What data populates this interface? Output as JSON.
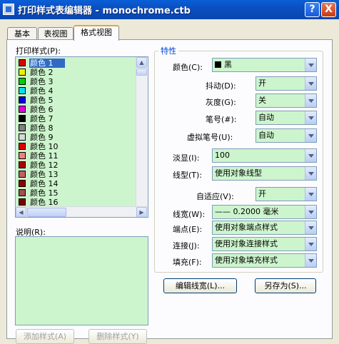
{
  "window": {
    "title": "打印样式表编辑器 - monochrome.ctb",
    "help_label": "?",
    "close_label": "X"
  },
  "tabs": [
    {
      "label": "基本"
    },
    {
      "label": "表视图"
    },
    {
      "label": "格式视图"
    }
  ],
  "styles_list": {
    "label": "打印样式(P):",
    "items": [
      {
        "label": "颜色 1",
        "color": "#e00000"
      },
      {
        "label": "颜色 2",
        "color": "#f0f000"
      },
      {
        "label": "颜色 3",
        "color": "#00d000"
      },
      {
        "label": "颜色 4",
        "color": "#00e0f0"
      },
      {
        "label": "颜色 5",
        "color": "#0000e0"
      },
      {
        "label": "颜色 6",
        "color": "#e000e0"
      },
      {
        "label": "颜色 7",
        "color": "#000000"
      },
      {
        "label": "颜色 8",
        "color": "#808080"
      },
      {
        "label": "颜色 9",
        "color": "#d8d8d8"
      },
      {
        "label": "颜色 10",
        "color": "#e00000"
      },
      {
        "label": "颜色 11",
        "color": "#f08080"
      },
      {
        "label": "颜色 12",
        "color": "#b00000"
      },
      {
        "label": "颜色 13",
        "color": "#c06060"
      },
      {
        "label": "颜色 14",
        "color": "#900000"
      },
      {
        "label": "颜色 15",
        "color": "#a05050"
      },
      {
        "label": "颜色 16",
        "color": "#800000"
      }
    ],
    "selected_index": 0
  },
  "description": {
    "label": "说明(R):",
    "value": ""
  },
  "buttons": {
    "add_style": "添加样式(A)",
    "delete_style": "删除样式(Y)",
    "edit_lineweights": "编辑线宽(L)...",
    "save_as": "另存为(S)..."
  },
  "properties": {
    "group_title": "特性",
    "color": {
      "label": "颜色(C):",
      "value": "黑"
    },
    "dither": {
      "label": "抖动(D):",
      "value": "开"
    },
    "grayscale": {
      "label": "灰度(G):",
      "value": "关"
    },
    "pen": {
      "label": "笔号(#):",
      "value": "自动"
    },
    "virtual_pen": {
      "label": "虚拟笔号(U):",
      "value": "自动"
    },
    "screening": {
      "label": "淡显(I):",
      "value": "100"
    },
    "linetype": {
      "label": "线型(T):",
      "value": "使用对象线型"
    },
    "adaptive": {
      "label": "自适应(V):",
      "value": "开"
    },
    "lineweight": {
      "label": "线宽(W):",
      "value": "—— 0.2000 毫米"
    },
    "line_end": {
      "label": "端点(E):",
      "value": "使用对象端点样式"
    },
    "line_join": {
      "label": "连接(J):",
      "value": "使用对象连接样式"
    },
    "fill": {
      "label": "填充(F):",
      "value": "使用对象填充样式"
    }
  }
}
